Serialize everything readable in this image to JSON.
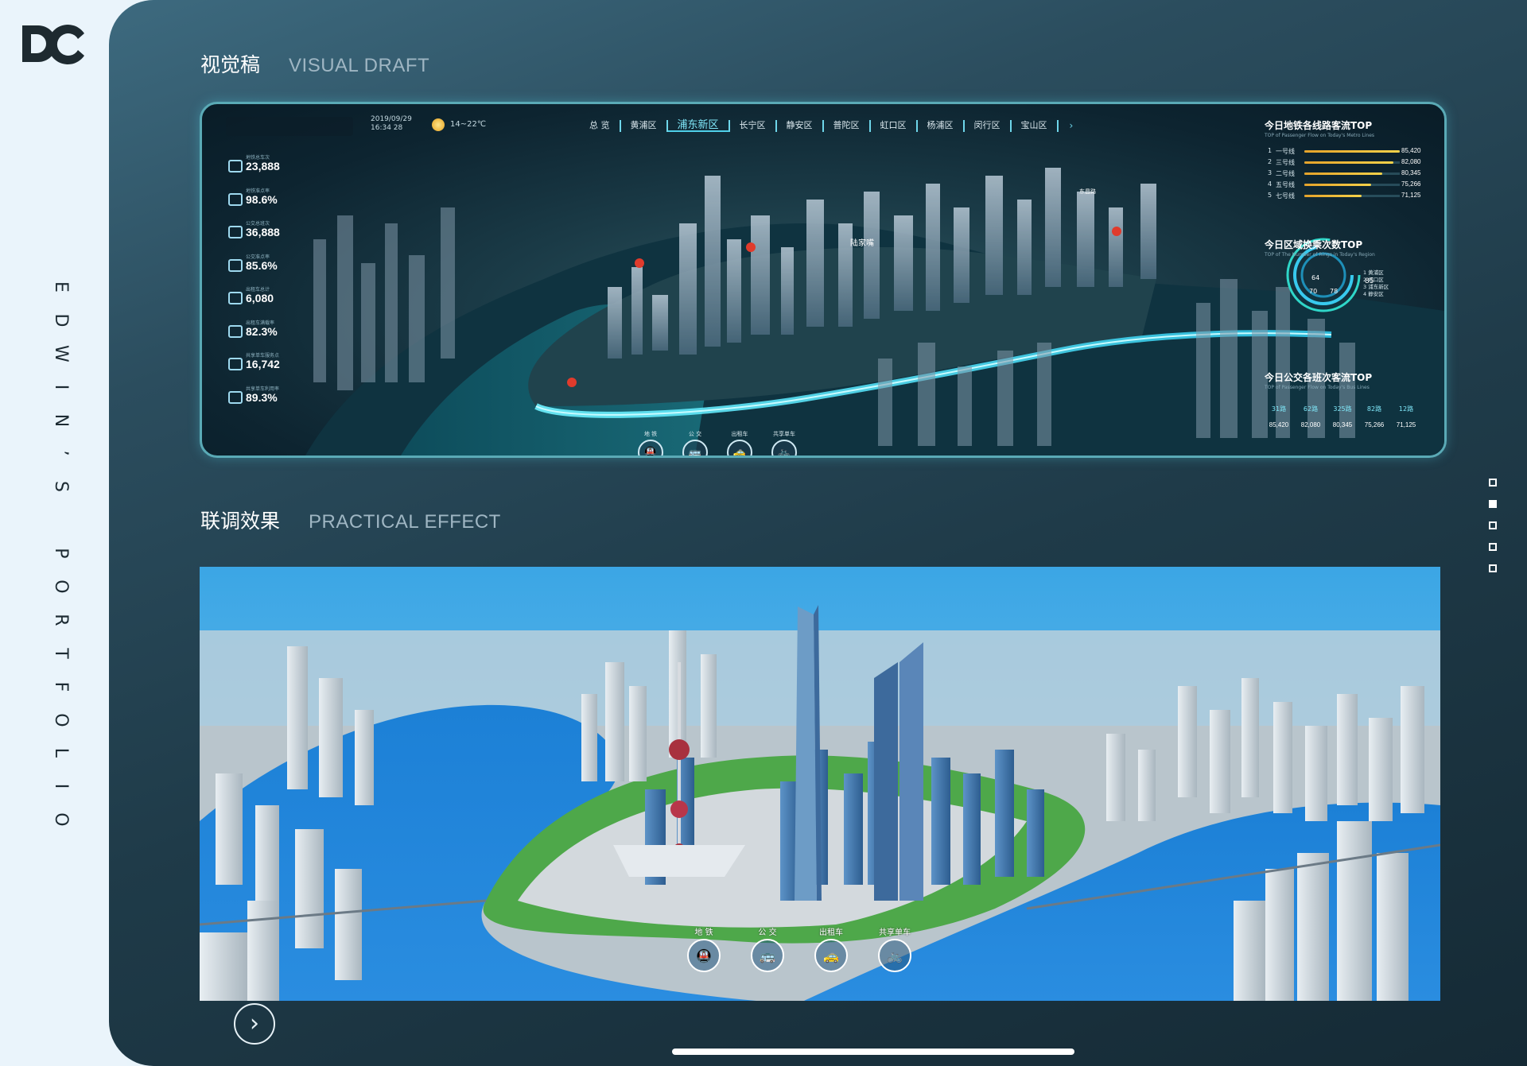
{
  "brand": {
    "logo_text": "DC",
    "vertical_text": [
      "E",
      "D",
      "W",
      "I",
      "N",
      "’",
      "S",
      "",
      "P",
      "O",
      "R",
      "T",
      "F",
      "O",
      "L",
      "I",
      "O"
    ]
  },
  "sections": {
    "visual": {
      "title_cn": "视觉稿",
      "title_en": "VISUAL DRAFT"
    },
    "practical": {
      "title_cn": "联调效果",
      "title_en": "PRACTICAL EFFECT"
    }
  },
  "dashboard": {
    "date": "2019/09/29",
    "time": "16:34 28",
    "temperature": "14~22℃",
    "tabs": [
      "总 览",
      "黄浦区",
      "浦东新区",
      "长宁区",
      "静安区",
      "普陀区",
      "虹口区",
      "杨浦区",
      "闵行区",
      "宝山区"
    ],
    "active_tab": "浦东新区",
    "kpis": [
      {
        "label": "地铁总车次",
        "value": "23,888",
        "icon": "metro-icon"
      },
      {
        "label": "地铁准点率",
        "value": "98.6%",
        "icon": "metro-punctual-icon"
      },
      {
        "label": "公交总班次",
        "value": "36,888",
        "icon": "bus-icon"
      },
      {
        "label": "公交准点率",
        "value": "85.6%",
        "icon": "bus-punctual-icon"
      },
      {
        "label": "出租车总计",
        "value": "6,080",
        "icon": "taxi-icon"
      },
      {
        "label": "出租车满载率",
        "value": "82.3%",
        "icon": "taxi-load-icon"
      },
      {
        "label": "共享单车服务点",
        "value": "16,742",
        "icon": "bike-point-icon"
      },
      {
        "label": "共享单车利用率",
        "value": "89.3%",
        "icon": "bike-icon"
      }
    ],
    "metro_panel": {
      "title": "今日地铁各线路客流TOP",
      "subtitle": "TOP of Passenger Flow on Today's Metro Lines",
      "rows": [
        {
          "rank": "1",
          "name": "一号线",
          "value": "85,420",
          "fraction": 1.0
        },
        {
          "rank": "2",
          "name": "三号线",
          "value": "82,080",
          "fraction": 0.93
        },
        {
          "rank": "3",
          "name": "二号线",
          "value": "80,345",
          "fraction": 0.82
        },
        {
          "rank": "4",
          "name": "五号线",
          "value": "75,266",
          "fraction": 0.7
        },
        {
          "rank": "5",
          "name": "七号线",
          "value": "71,125",
          "fraction": 0.6
        }
      ]
    },
    "region_panel": {
      "title": "今日区域换乘次数TOP",
      "subtitle": "TOP of The Number of Rings in Today's Region",
      "list": [
        "1 黄浦区",
        "2 虹口区",
        "3 浦东新区",
        "4 静安区"
      ],
      "gauge_values": [
        "64",
        "70",
        "78",
        "85"
      ]
    },
    "bus_panel": {
      "title": "今日公交各班次客流TOP",
      "subtitle": "TOP of Passenger Flow on Today's Bus Lines",
      "routes": [
        "31路",
        "62路",
        "325路",
        "82路",
        "12路"
      ],
      "values": [
        "85,420",
        "82,080",
        "80,345",
        "75,266",
        "71,125"
      ]
    },
    "map_labels": {
      "poi1": "陆家嘴",
      "poi2": "东昌路"
    },
    "modes": [
      "地 铁",
      "公 交",
      "出租车",
      "共享单车"
    ]
  },
  "practical_modes": [
    "地 铁",
    "公 交",
    "出租车",
    "共享单车"
  ],
  "colors": {
    "accent": "#5fd6ea",
    "bar": "#f0c23a",
    "bg_panel": "#1f3b49"
  }
}
